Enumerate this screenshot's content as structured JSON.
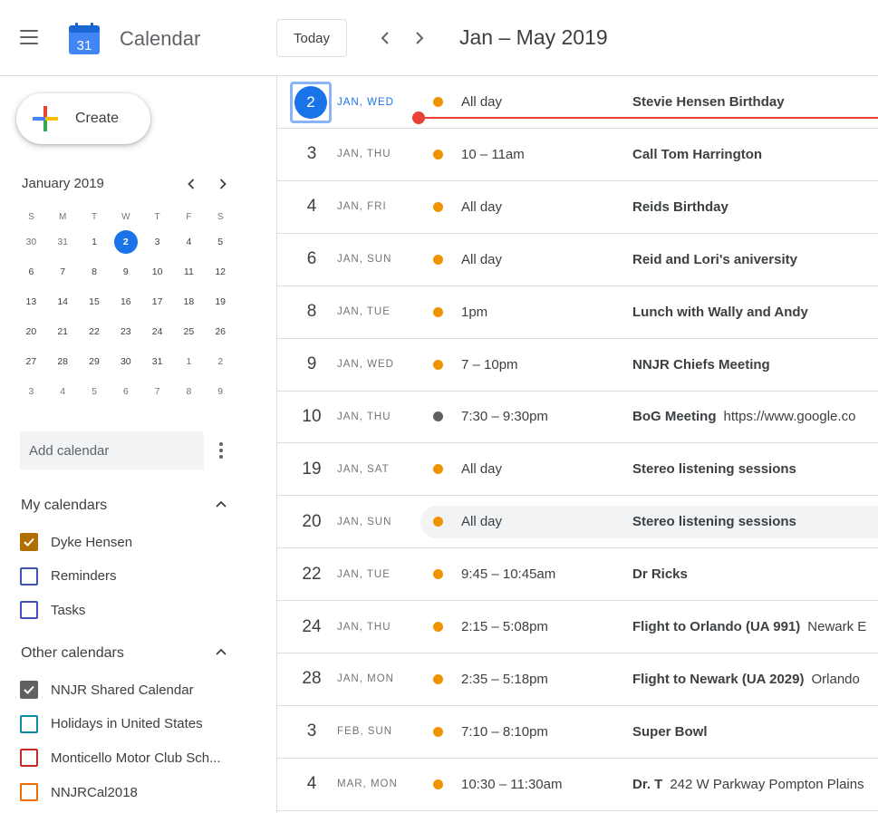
{
  "header": {
    "logo_day": "31",
    "app_title": "Calendar",
    "today_label": "Today",
    "prev_icon": "chevron-left-icon",
    "next_icon": "chevron-right-icon",
    "range_title": "Jan – May 2019"
  },
  "sidebar": {
    "create_label": "Create",
    "mini_calendar": {
      "month_label": "January 2019",
      "weekdays": [
        "S",
        "M",
        "T",
        "W",
        "T",
        "F",
        "S"
      ],
      "weeks": [
        [
          "30",
          "31",
          "1",
          "2",
          "3",
          "4",
          "5"
        ],
        [
          "6",
          "7",
          "8",
          "9",
          "10",
          "11",
          "12"
        ],
        [
          "13",
          "14",
          "15",
          "16",
          "17",
          "18",
          "19"
        ],
        [
          "20",
          "21",
          "22",
          "23",
          "24",
          "25",
          "26"
        ],
        [
          "27",
          "28",
          "29",
          "30",
          "31",
          "1",
          "2"
        ],
        [
          "3",
          "4",
          "5",
          "6",
          "7",
          "8",
          "9"
        ]
      ],
      "today": "2"
    },
    "add_calendar_placeholder": "Add calendar",
    "my_calendars_title": "My calendars",
    "my_calendars": [
      {
        "label": "Dyke Hensen",
        "color": "#b06e00",
        "checked": true
      },
      {
        "label": "Reminders",
        "color": "#3f51b5",
        "checked": false
      },
      {
        "label": "Tasks",
        "color": "#3f51b5",
        "checked": false
      }
    ],
    "other_calendars_title": "Other calendars",
    "other_calendars": [
      {
        "label": "NNJR Shared Calendar",
        "color": "#616161",
        "checked": true
      },
      {
        "label": "Holidays in United States",
        "color": "#0b8aa8",
        "checked": false
      },
      {
        "label": "Monticello Motor Club Sch...",
        "color": "#c62828",
        "checked": false
      },
      {
        "label": "NNJRCal2018",
        "color": "#ef6c00",
        "checked": false
      }
    ]
  },
  "agenda": {
    "colors": {
      "orange": "#f09300",
      "gray": "#616161",
      "today_blue": "#1a73e8",
      "now_red": "#ea4335"
    },
    "events": [
      {
        "day": "2",
        "dow": "JAN, WED",
        "time": "All day",
        "title": "Stevie Hensen Birthday",
        "extra": "",
        "dot": "#f09300",
        "today": true
      },
      {
        "day": "3",
        "dow": "JAN, THU",
        "time": "10 – 11am",
        "title": "Call Tom Harrington",
        "extra": "",
        "dot": "#f09300"
      },
      {
        "day": "4",
        "dow": "JAN, FRI",
        "time": "All day",
        "title": "Reids Birthday",
        "extra": "",
        "dot": "#f09300"
      },
      {
        "day": "6",
        "dow": "JAN, SUN",
        "time": "All day",
        "title": "Reid and Lori's aniversity",
        "extra": "",
        "dot": "#f09300"
      },
      {
        "day": "8",
        "dow": "JAN, TUE",
        "time": "1pm",
        "title": "Lunch with Wally and Andy",
        "extra": "",
        "dot": "#f09300"
      },
      {
        "day": "9",
        "dow": "JAN, WED",
        "time": "7 – 10pm",
        "title": "NNJR Chiefs Meeting",
        "extra": "",
        "dot": "#f09300"
      },
      {
        "day": "10",
        "dow": "JAN, THU",
        "time": "7:30 – 9:30pm",
        "title": "BoG Meeting",
        "extra": "https://www.google.co",
        "dot": "#616161"
      },
      {
        "day": "19",
        "dow": "JAN, SAT",
        "time": "All day",
        "title": "Stereo listening sessions",
        "extra": "",
        "dot": "#f09300"
      },
      {
        "day": "20",
        "dow": "JAN, SUN",
        "time": "All day",
        "title": "Stereo listening sessions",
        "extra": "",
        "dot": "#f09300",
        "hover": true
      },
      {
        "day": "22",
        "dow": "JAN, TUE",
        "time": "9:45 – 10:45am",
        "title": "Dr Ricks",
        "extra": "",
        "dot": "#f09300"
      },
      {
        "day": "24",
        "dow": "JAN, THU",
        "time": "2:15 – 5:08pm",
        "title": "Flight to Orlando (UA 991)",
        "extra": "Newark E",
        "dot": "#f09300"
      },
      {
        "day": "28",
        "dow": "JAN, MON",
        "time": "2:35 – 5:18pm",
        "title": "Flight to Newark (UA 2029)",
        "extra": "Orlando",
        "dot": "#f09300"
      },
      {
        "day": "3",
        "dow": "FEB, SUN",
        "time": "7:10 – 8:10pm",
        "title": "Super Bowl",
        "extra": "",
        "dot": "#f09300"
      },
      {
        "day": "4",
        "dow": "MAR, MON",
        "time": "10:30 – 11:30am",
        "title": "Dr. T",
        "extra": "242 W Parkway Pompton Plains",
        "dot": "#f09300"
      }
    ]
  }
}
